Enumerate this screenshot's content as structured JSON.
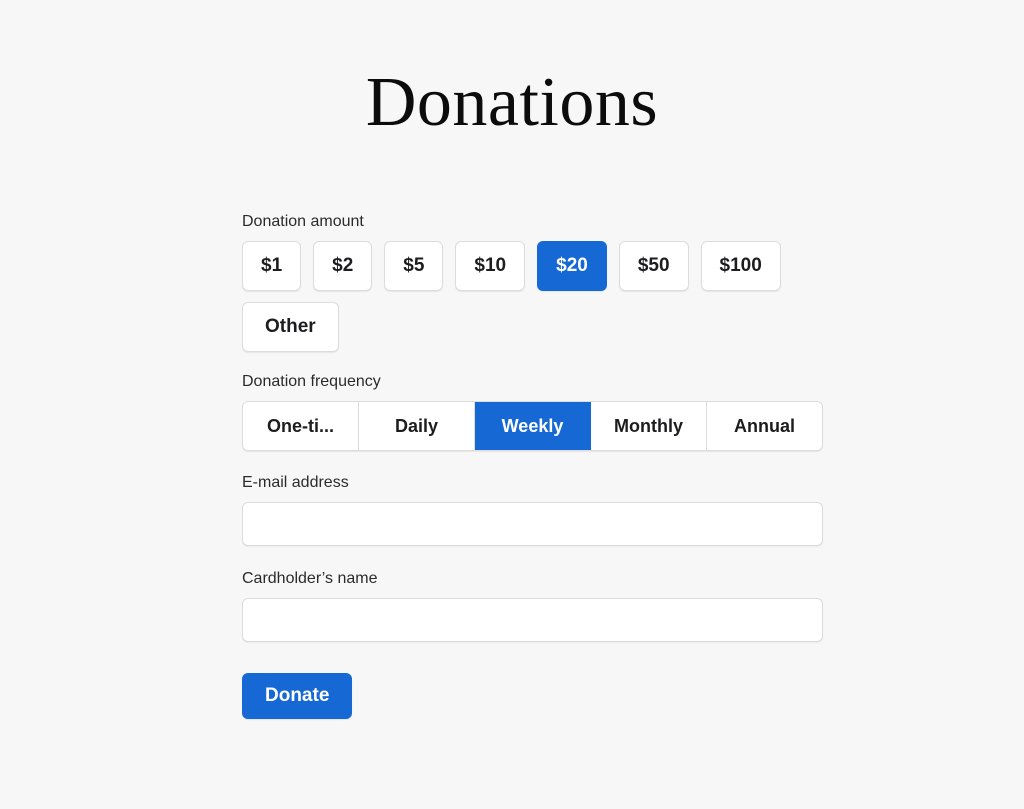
{
  "page": {
    "title": "Donations",
    "background_color": "#f7f7f7",
    "accent_color": "#1668d4"
  },
  "amount_section": {
    "label": "Donation amount",
    "selected": "$20",
    "options": [
      {
        "label": "$1",
        "selected": false
      },
      {
        "label": "$2",
        "selected": false
      },
      {
        "label": "$5",
        "selected": false
      },
      {
        "label": "$10",
        "selected": false
      },
      {
        "label": "$20",
        "selected": true
      },
      {
        "label": "$50",
        "selected": false
      },
      {
        "label": "$100",
        "selected": false
      },
      {
        "label": "Other",
        "selected": false
      }
    ]
  },
  "frequency_section": {
    "label": "Donation frequency",
    "selected": "Weekly",
    "options": [
      {
        "label": "One-ti...",
        "selected": false
      },
      {
        "label": "Daily",
        "selected": false
      },
      {
        "label": "Weekly",
        "selected": true
      },
      {
        "label": "Monthly",
        "selected": false
      },
      {
        "label": "Annual",
        "selected": false
      }
    ]
  },
  "email_field": {
    "label": "E-mail address",
    "value": "",
    "placeholder": ""
  },
  "cardholder_field": {
    "label": "Cardholder’s name",
    "value": "",
    "placeholder": ""
  },
  "submit": {
    "label": "Donate"
  }
}
